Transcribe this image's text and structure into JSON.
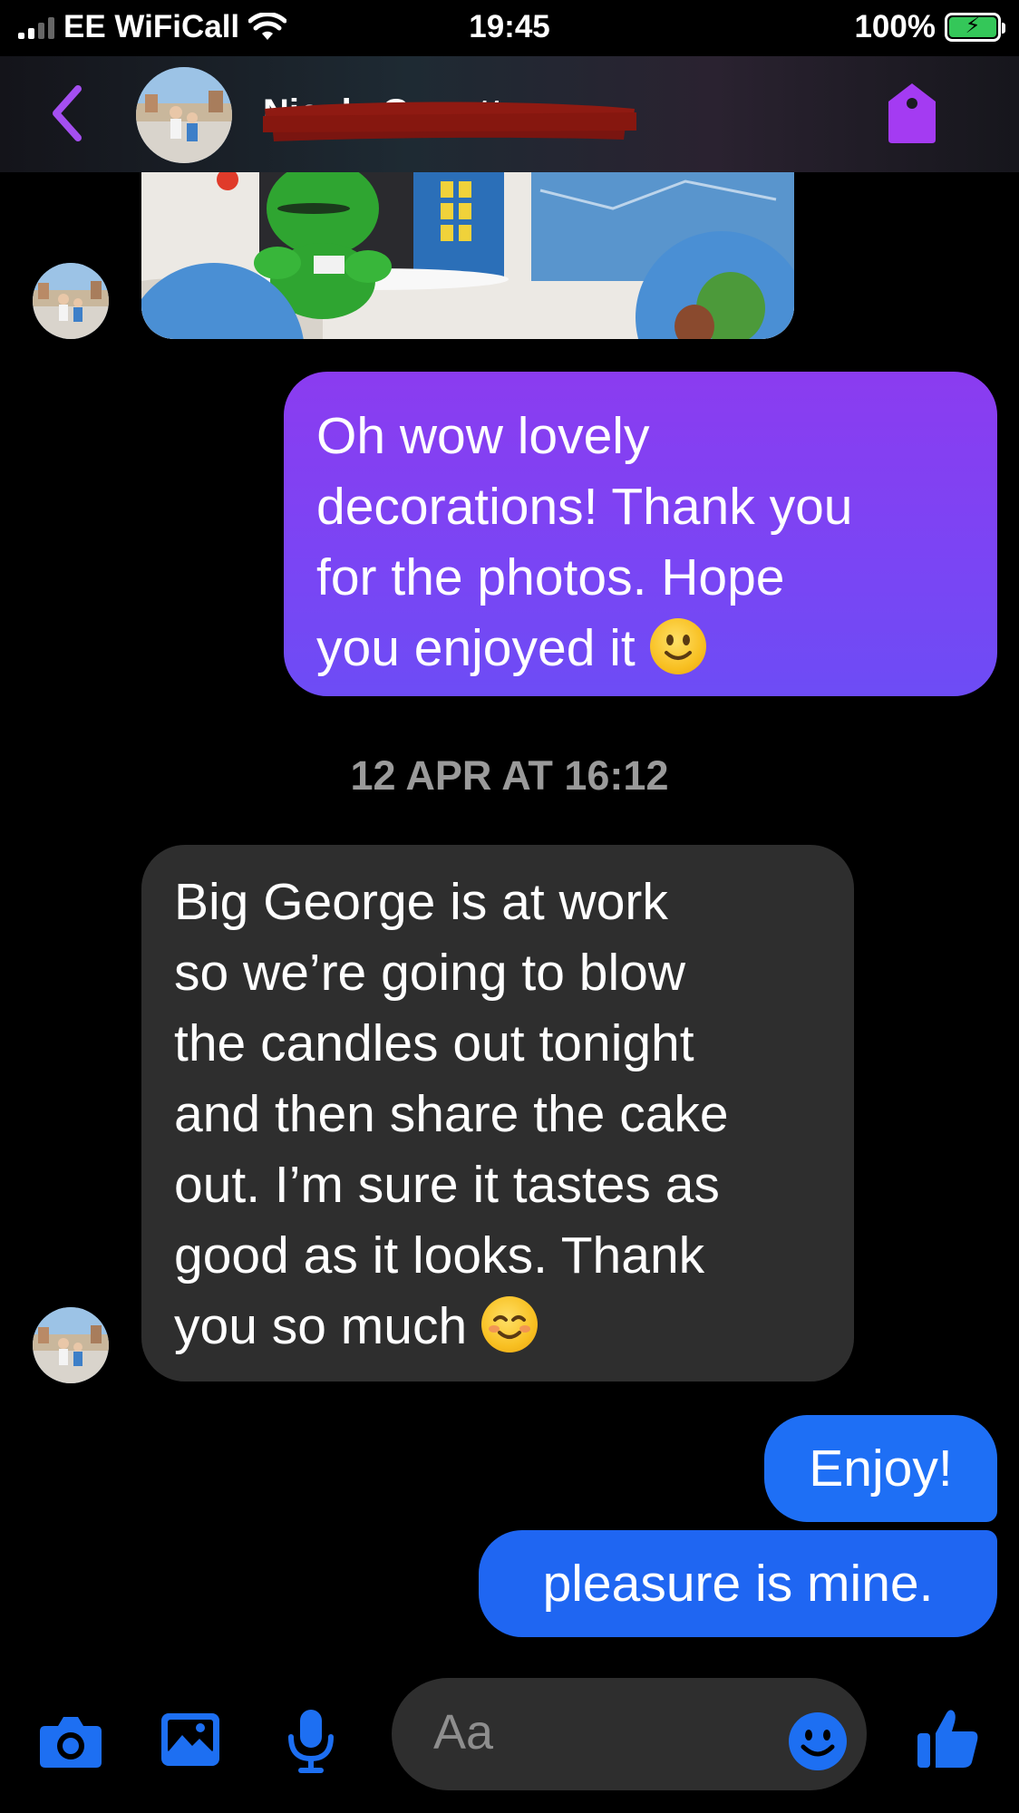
{
  "status_bar": {
    "carrier": "EE WiFiCall",
    "time": "19:45",
    "battery": "100%",
    "battery_level": 1.0
  },
  "header": {
    "contact_name": "Nicola Garratt",
    "icons": [
      "back-icon",
      "tag-icon"
    ]
  },
  "messages": [
    {
      "type": "incoming-photo",
      "sender": "contact",
      "description_icon": "cake-photo"
    },
    {
      "type": "outgoing",
      "lines": [
        "Oh wow lovely",
        "decorations! Thank you",
        "for the photos. Hope",
        "you enjoyed it"
      ],
      "emoji": "slightly-smiling-face"
    },
    {
      "type": "timestamp",
      "text": "12 APR AT 16:12"
    },
    {
      "type": "incoming",
      "lines": [
        "Big George is at work",
        "so we’re going to blow",
        "the candles out tonight",
        "and then share the cake",
        "out. I’m sure it tastes as",
        "good as it looks. Thank",
        "you so much"
      ],
      "emoji": "smiling-face"
    },
    {
      "type": "outgoing",
      "text": "Enjoy!"
    },
    {
      "type": "outgoing",
      "text": "pleasure is mine."
    }
  ],
  "composer": {
    "placeholder": "Aa",
    "icons": [
      "camera-icon",
      "gallery-icon",
      "microphone-icon",
      "emoji-icon",
      "thumbs-up-icon"
    ]
  },
  "colors": {
    "accent_purple": "#8a3bef",
    "outgoing_blue": "#1e6ff5",
    "incoming_gray": "#2e2e2e",
    "icon_blue": "#1d6ff2"
  }
}
